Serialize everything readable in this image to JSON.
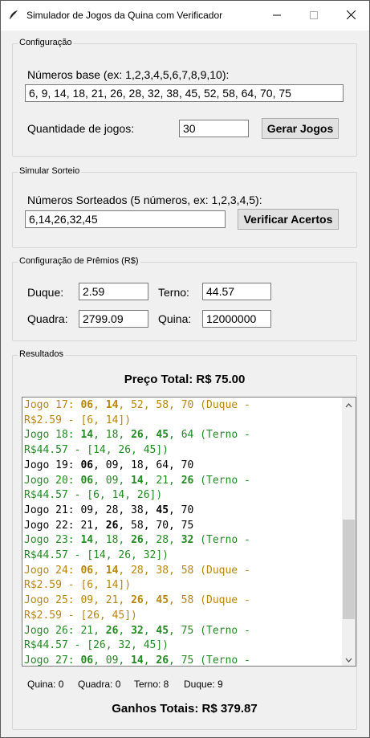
{
  "window": {
    "title": "Simulador de Jogos da Quina com Verificador"
  },
  "config": {
    "group_title": "Configuração",
    "base_label": "Números base (ex: 1,2,3,4,5,6,7,8,9,10):",
    "base_value": "6, 9, 14, 18, 21, 26, 28, 32, 38, 45, 52, 58, 64, 70, 75",
    "qty_label": "Quantidade de jogos:",
    "qty_value": "30",
    "gen_button": "Gerar Jogos"
  },
  "draw": {
    "group_title": "Simular Sorteio",
    "label": "Números Sorteados (5 números, ex: 1,2,3,4,5):",
    "value": "6,14,26,32,45",
    "verify_button": "Verificar Acertos"
  },
  "prizes": {
    "group_title": "Configuração de Prêmios (R$)",
    "duque_label": "Duque:",
    "duque_value": "2.59",
    "terno_label": "Terno:",
    "terno_value": "44.57",
    "quadra_label": "Quadra:",
    "quadra_value": "2799.09",
    "quina_label": "Quina:",
    "quina_value": "12000000"
  },
  "results": {
    "group_title": "Resultados",
    "total_price": "Preço Total: R$ 75.00",
    "lines": [
      {
        "cls": "c-duque",
        "b": true,
        "parts": [
          [
            "Jogo 17: ",
            false
          ],
          [
            "06",
            true
          ],
          [
            ", ",
            false
          ],
          [
            "14",
            true
          ],
          [
            ", 52, 58, 70 (Duque -",
            false
          ]
        ]
      },
      {
        "cls": "c-duque",
        "parts": [
          [
            "R$2.59 - [6, 14])",
            false
          ]
        ]
      },
      {
        "cls": "c-terno",
        "parts": [
          [
            "Jogo 18: ",
            false
          ],
          [
            "14",
            true
          ],
          [
            ", 18, ",
            false
          ],
          [
            "26",
            true
          ],
          [
            ", ",
            false
          ],
          [
            "45",
            true
          ],
          [
            ", 64 (Terno -",
            false
          ]
        ]
      },
      {
        "cls": "c-terno",
        "parts": [
          [
            "R$44.57 - [14, 26, 45])",
            false
          ]
        ]
      },
      {
        "cls": "c-none",
        "parts": [
          [
            "Jogo 19: ",
            false
          ],
          [
            "06",
            true
          ],
          [
            ", 09, 18, 64, 70",
            false
          ]
        ]
      },
      {
        "cls": "c-terno",
        "parts": [
          [
            "Jogo 20: ",
            false
          ],
          [
            "06",
            true
          ],
          [
            ", 09, ",
            false
          ],
          [
            "14",
            true
          ],
          [
            ", 21, ",
            false
          ],
          [
            "26",
            true
          ],
          [
            " (Terno -",
            false
          ]
        ]
      },
      {
        "cls": "c-terno",
        "parts": [
          [
            "R$44.57 - [6, 14, 26])",
            false
          ]
        ]
      },
      {
        "cls": "c-none",
        "parts": [
          [
            "Jogo 21: 09, 28, 38, ",
            false
          ],
          [
            "45",
            true
          ],
          [
            ", 70",
            false
          ]
        ]
      },
      {
        "cls": "c-none",
        "parts": [
          [
            "Jogo 22: 21, ",
            false
          ],
          [
            "26",
            true
          ],
          [
            ", 58, 70, 75",
            false
          ]
        ]
      },
      {
        "cls": "c-terno",
        "parts": [
          [
            "Jogo 23: ",
            false
          ],
          [
            "14",
            true
          ],
          [
            ", 18, ",
            false
          ],
          [
            "26",
            true
          ],
          [
            ", 28, ",
            false
          ],
          [
            "32",
            true
          ],
          [
            " (Terno -",
            false
          ]
        ]
      },
      {
        "cls": "c-terno",
        "parts": [
          [
            "R$44.57 - [14, 26, 32])",
            false
          ]
        ]
      },
      {
        "cls": "c-duque",
        "parts": [
          [
            "Jogo 24: ",
            false
          ],
          [
            "06",
            true
          ],
          [
            ", ",
            false
          ],
          [
            "14",
            true
          ],
          [
            ", 28, 38, 58 (Duque -",
            false
          ]
        ]
      },
      {
        "cls": "c-duque",
        "parts": [
          [
            "R$2.59 - [6, 14])",
            false
          ]
        ]
      },
      {
        "cls": "c-duque",
        "parts": [
          [
            "Jogo 25: 09, 21, ",
            false
          ],
          [
            "26",
            true
          ],
          [
            ", ",
            false
          ],
          [
            "45",
            true
          ],
          [
            ", 58 (Duque -",
            false
          ]
        ]
      },
      {
        "cls": "c-duque",
        "parts": [
          [
            "R$2.59 - [26, 45])",
            false
          ]
        ]
      },
      {
        "cls": "c-terno",
        "parts": [
          [
            "Jogo 26: 21, ",
            false
          ],
          [
            "26",
            true
          ],
          [
            ", ",
            false
          ],
          [
            "32",
            true
          ],
          [
            ", ",
            false
          ],
          [
            "45",
            true
          ],
          [
            ", 75 (Terno -",
            false
          ]
        ]
      },
      {
        "cls": "c-terno",
        "parts": [
          [
            "R$44.57 - [26, 32, 45])",
            false
          ]
        ]
      },
      {
        "cls": "c-terno",
        "parts": [
          [
            "Jogo 27: ",
            false
          ],
          [
            "06",
            true
          ],
          [
            ", 09, ",
            false
          ],
          [
            "14",
            true
          ],
          [
            ", ",
            false
          ],
          [
            "26",
            true
          ],
          [
            ", 75 (Terno -",
            false
          ]
        ]
      }
    ],
    "stat_quina": "Quina: 0",
    "stat_quadra": "Quadra: 0",
    "stat_terno": "Terno: 8",
    "stat_duque": "Duque: 9",
    "total_winnings": "Ganhos Totais: R$ 379.87"
  },
  "colors": {
    "duque": "#b8860b",
    "terno": "#228b22"
  }
}
